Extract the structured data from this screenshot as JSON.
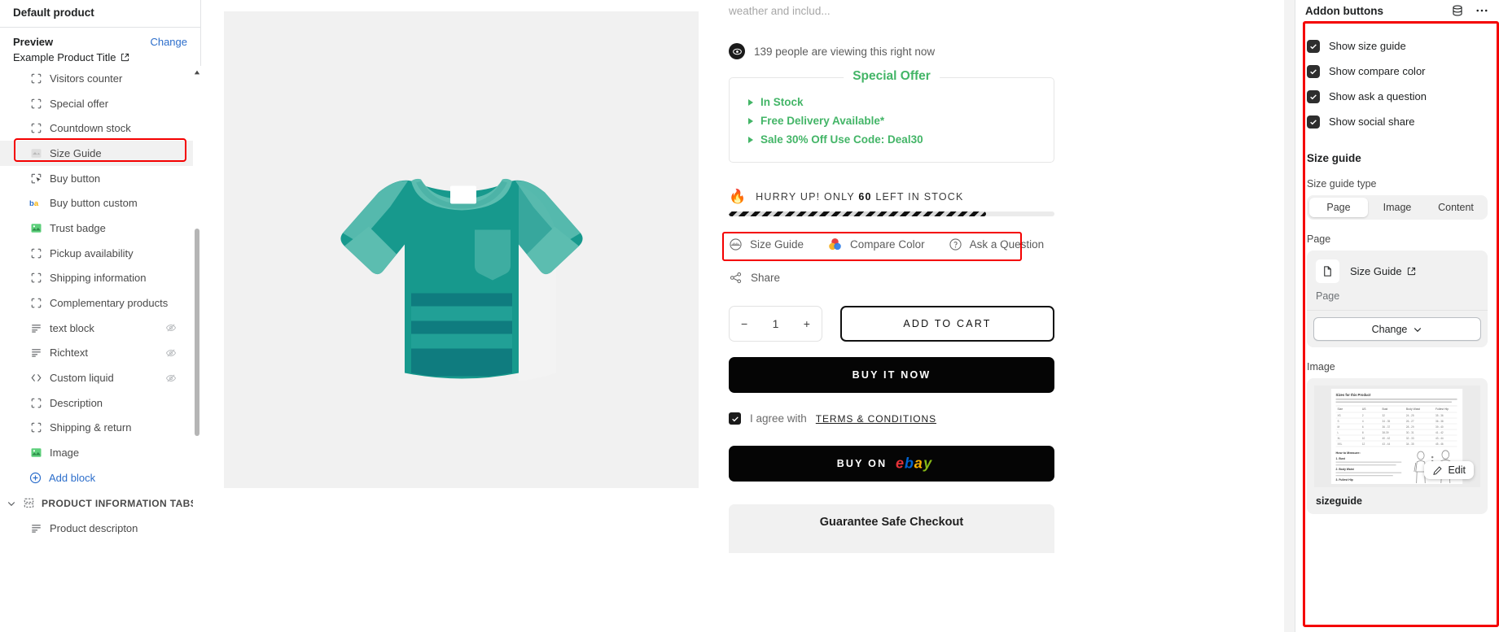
{
  "sidebar": {
    "title": "Default product",
    "preview_label": "Preview",
    "change_label": "Change",
    "preview_title": "Example Product Title",
    "blocks": [
      {
        "label": "Visitors counter",
        "icon": "placeholder-block-icon",
        "hidden": false
      },
      {
        "label": "Special offer",
        "icon": "placeholder-block-icon",
        "hidden": false
      },
      {
        "label": "Countdown stock",
        "icon": "placeholder-block-icon",
        "hidden": false
      },
      {
        "label": "Size Guide",
        "icon": "app-block-icon",
        "hidden": false,
        "selected": true
      },
      {
        "label": "Buy button",
        "icon": "cursor-click-icon",
        "hidden": false
      },
      {
        "label": "Buy button custom",
        "icon": "app-badge-icon",
        "hidden": false
      },
      {
        "label": "Trust badge",
        "icon": "image-block-icon",
        "hidden": false
      },
      {
        "label": "Pickup availability",
        "icon": "placeholder-block-icon",
        "hidden": false
      },
      {
        "label": "Shipping information",
        "icon": "placeholder-block-icon",
        "hidden": false
      },
      {
        "label": "Complementary products",
        "icon": "placeholder-block-icon",
        "hidden": false
      },
      {
        "label": "text block",
        "icon": "text-block-icon",
        "hidden": true
      },
      {
        "label": "Richtext",
        "icon": "text-block-icon",
        "hidden": true
      },
      {
        "label": "Custom liquid",
        "icon": "code-icon",
        "hidden": true
      },
      {
        "label": "Description",
        "icon": "placeholder-block-icon",
        "hidden": false
      },
      {
        "label": "Shipping & return",
        "icon": "placeholder-block-icon",
        "hidden": false
      },
      {
        "label": "Image",
        "icon": "image-block-icon",
        "hidden": false
      }
    ],
    "add_block": "Add block",
    "group_label": "PRODUCT INFORMATION TABS",
    "group_child": "Product descripton"
  },
  "preview": {
    "description_fragment": "weather and includ...",
    "viewers_text": "139 people are viewing this right now",
    "offer": {
      "legend": "Special Offer",
      "items": [
        "In Stock",
        "Free Delivery Available*",
        "Sale 30% Off Use Code: Deal30"
      ]
    },
    "hurry_prefix": "HURRY UP! ONLY",
    "hurry_count": "60",
    "hurry_suffix": "LEFT IN STOCK",
    "addons": [
      {
        "label": "Size Guide",
        "icon": "size-guide-icon"
      },
      {
        "label": "Compare Color",
        "icon": "compare-color-icon"
      },
      {
        "label": "Ask a Question",
        "icon": "question-circle-icon"
      }
    ],
    "share_label": "Share",
    "quantity": {
      "minus": "−",
      "value": "1",
      "plus": "+"
    },
    "add_to_cart": "ADD TO CART",
    "buy_it_now": "BUY IT NOW",
    "terms_prefix": "I agree with",
    "terms_link": "TERMS & CONDITIONS",
    "buy_on_prefix": "BUY ON",
    "ebay_brand": "ebay",
    "guarantee": "Guarantee Safe Checkout"
  },
  "right_panel": {
    "title": "Addon buttons",
    "checkboxes": [
      {
        "label": "Show size guide",
        "checked": true
      },
      {
        "label": "Show compare color",
        "checked": true
      },
      {
        "label": "Show ask a question",
        "checked": true
      },
      {
        "label": "Show social share",
        "checked": true
      }
    ],
    "size_guide_heading": "Size guide",
    "type_label": "Size guide type",
    "type_options": [
      "Page",
      "Image",
      "Content"
    ],
    "type_selected": "Page",
    "page_label": "Page",
    "picked_page_name": "Size Guide",
    "picked_page_sub": "Page",
    "change_button": "Change",
    "image_label": "Image",
    "edit_label": "Edit",
    "image_name": "sizeguide",
    "thumb_title": "Sizes for this Product",
    "thumb_table_headers": [
      "Size",
      "US",
      "Bust",
      "Body Waist",
      "Fullest Hip"
    ],
    "thumb_rows": [
      [
        "XS",
        "2",
        "32",
        "24 - 25",
        "35 - 36"
      ],
      [
        "S",
        "4",
        "34 - 35",
        "26 - 27",
        "36 - 38"
      ],
      [
        "M",
        "6",
        "36 - 37",
        "28 - 29",
        "39 - 40"
      ],
      [
        "L",
        "8",
        "38-39",
        "30 - 31",
        "41 - 42"
      ],
      [
        "XL",
        "10",
        "40 - 42",
        "32 - 33",
        "43 - 44"
      ],
      [
        "XXL",
        "12",
        "43 - 44",
        "34 - 35",
        "45 - 46"
      ]
    ],
    "thumb_howto": "How to Measure:",
    "thumb_steps": [
      "1. Bust",
      "2. Body Waist",
      "3. Fullest Hip"
    ]
  },
  "colors": {
    "accent_blue": "#2c6ecb",
    "highlight_red": "#f40000",
    "offer_green": "#43b567",
    "shirt_teal": "#159a8c"
  }
}
